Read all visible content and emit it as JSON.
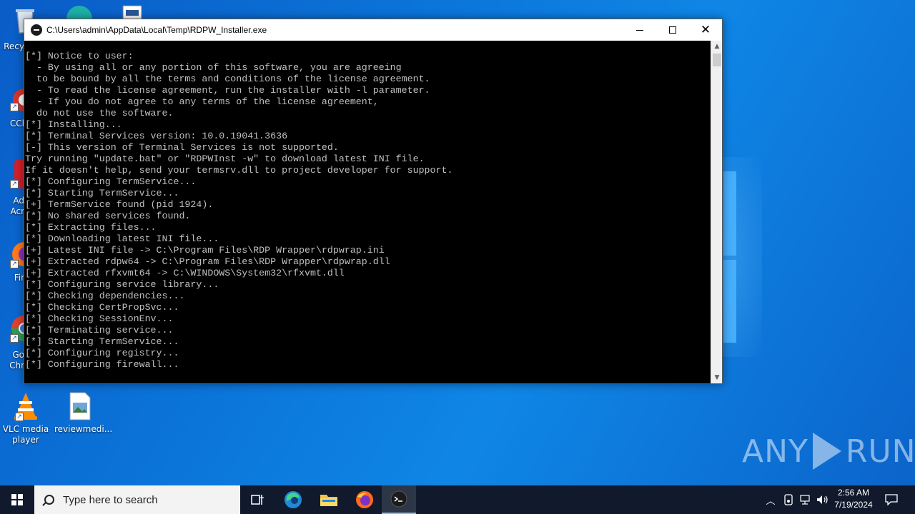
{
  "desktop": {
    "icons": [
      {
        "label": "Recy"
      },
      {
        "label": "CCl"
      },
      {
        "label": "Ad\nAcr"
      },
      {
        "label": "Fir"
      },
      {
        "label": "Go\nChr"
      },
      {
        "label": "VLC media\nplayer"
      },
      {
        "label": "reviewmedi..."
      }
    ]
  },
  "console": {
    "title": "C:\\Users\\admin\\AppData\\Local\\Temp\\RDPW_Installer.exe",
    "lines": [
      "[*] Notice to user:",
      "  - By using all or any portion of this software, you are agreeing",
      "  to be bound by all the terms and conditions of the license agreement.",
      "  - To read the license agreement, run the installer with -l parameter.",
      "  - If you do not agree to any terms of the license agreement,",
      "  do not use the software.",
      "[*] Installing...",
      "[*] Terminal Services version: 10.0.19041.3636",
      "[-] This version of Terminal Services is not supported.",
      "Try running \"update.bat\" or \"RDPWInst -w\" to download latest INI file.",
      "If it doesn't help, send your termsrv.dll to project developer for support.",
      "[*] Configuring TermService...",
      "[*] Starting TermService...",
      "[+] TermService found (pid 1924).",
      "[*] No shared services found.",
      "[*] Extracting files...",
      "[*] Downloading latest INI file...",
      "[+] Latest INI file -> C:\\Program Files\\RDP Wrapper\\rdpwrap.ini",
      "[+] Extracted rdpw64 -> C:\\Program Files\\RDP Wrapper\\rdpwrap.dll",
      "[+] Extracted rfxvmt64 -> C:\\WINDOWS\\System32\\rfxvmt.dll",
      "[*] Configuring service library...",
      "[*] Checking dependencies...",
      "[*] Checking CertPropSvc...",
      "[*] Checking SessionEnv...",
      "[*] Terminating service...",
      "[*] Starting TermService...",
      "[*] Configuring registry...",
      "[*] Configuring firewall..."
    ]
  },
  "watermark": {
    "left": "ANY",
    "right": "RUN"
  },
  "taskbar": {
    "search_placeholder": "Type here to search",
    "clock_time": "2:56 AM",
    "clock_date": "7/19/2024"
  }
}
